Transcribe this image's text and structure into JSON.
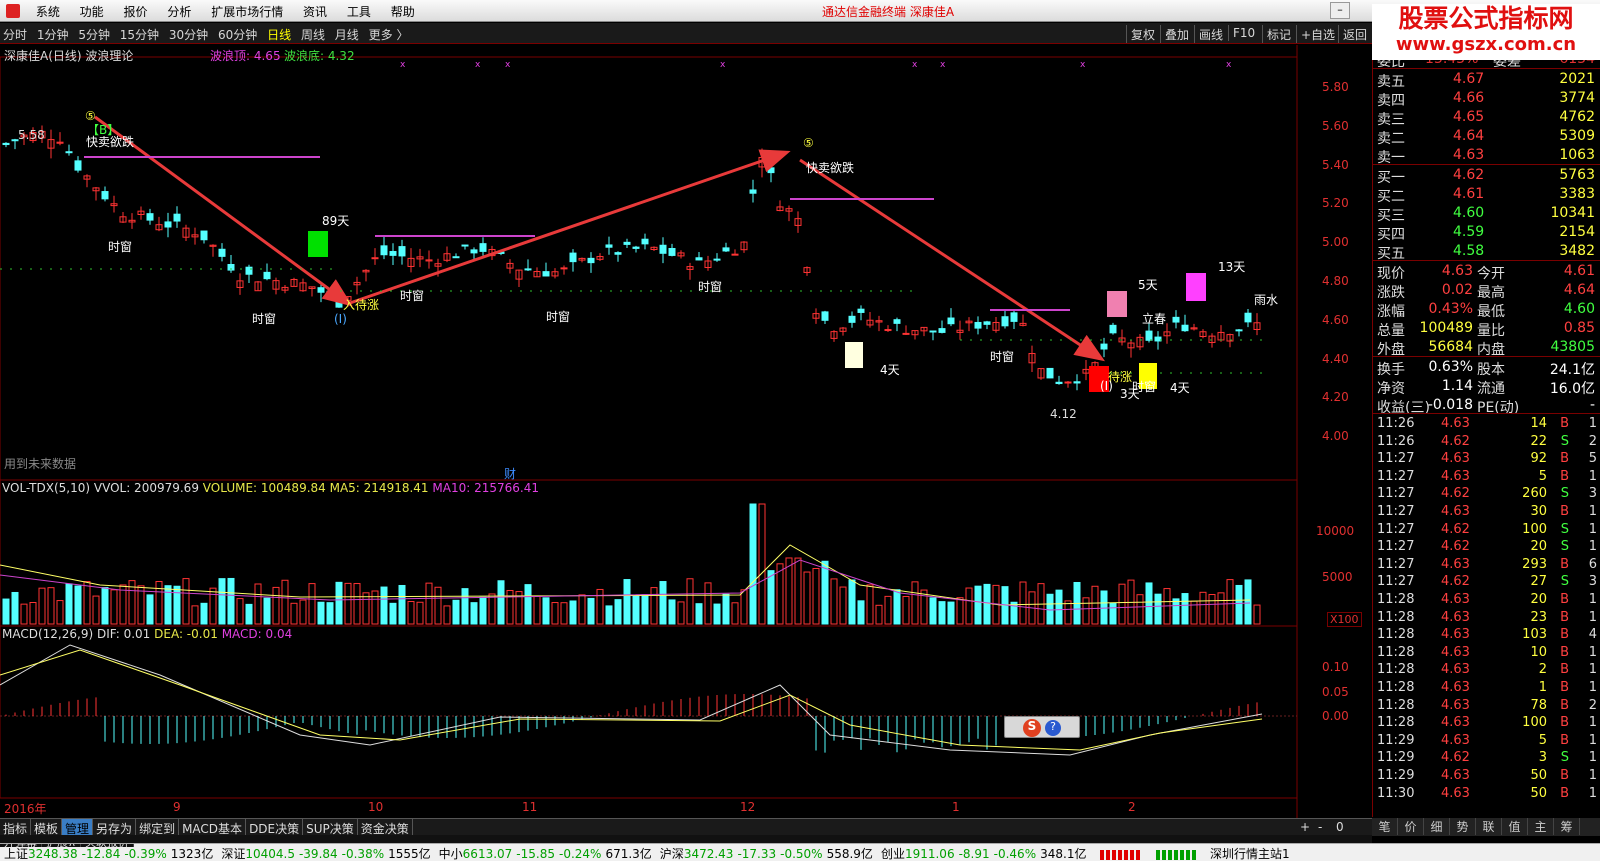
{
  "menu": {
    "items": [
      "系统",
      "功能",
      "报价",
      "分析",
      "扩展市场行情",
      "资讯",
      "工具",
      "帮助"
    ],
    "title": "通达信金融终端  深康佳A"
  },
  "toolbar": {
    "periods": [
      "分时",
      "1分钟",
      "5分钟",
      "15分钟",
      "30分钟",
      "60分钟",
      "日线",
      "周线",
      "月线",
      "更多 〉"
    ],
    "active": "日线",
    "right": [
      "复权",
      "叠加",
      "画线",
      "F10",
      "标记",
      "+自选",
      "返回"
    ]
  },
  "logo": {
    "line1": "股票公式指标网",
    "line2": "www.gszx.com.cn"
  },
  "main_chart": {
    "title": "深康佳A(日线) 波浪理论",
    "wave_top_label": "波浪顶: 4.65",
    "wave_bottom_label": "波浪底: 4.32",
    "price_axis": [
      "5.80",
      "5.60",
      "5.40",
      "5.20",
      "5.00",
      "4.80",
      "4.60",
      "4.40",
      "4.20",
      "4.00"
    ],
    "high_label": "5.58",
    "low_label": "4.12",
    "future_data_note": "用到未来数据",
    "cai_marker": "财",
    "annotations": [
      "时窗",
      "时窗",
      "时窗",
      "时窗",
      "时窗",
      "时窗",
      "时窗",
      "快卖欲跌",
      "快卖欲跌",
      "入待涨",
      "待涨",
      "立春",
      "雨水",
      "89天",
      "5天",
      "13天",
      "4天",
      "3天",
      "4天",
      "(I)",
      "(I)",
      "⑤",
      "⑤",
      "【B】"
    ]
  },
  "volume_panel": {
    "title": "VOL-TDX(5,10)",
    "vvol": "VVOL: 200979.69",
    "volume": "VOLUME: 100489.84",
    "ma5": "MA5: 214918.41",
    "ma10": "MA10: 215766.41",
    "axis": [
      "10000",
      "5000"
    ],
    "unit": "X100"
  },
  "macd_panel": {
    "title": "MACD(12,26,9)",
    "dif": "DIF: 0.01",
    "dea": "DEA: -0.01",
    "macd": "MACD: 0.04",
    "axis": [
      "0.10",
      "0.05",
      "0.00"
    ]
  },
  "date_axis": [
    "2016年",
    "9",
    "10",
    "11",
    "12",
    "1",
    "2"
  ],
  "quote": {
    "header": {
      "label": "委比",
      "value": "13.43%",
      "label2": "委差",
      "value2": "6134"
    },
    "asks": [
      {
        "label": "卖五",
        "price": "4.67",
        "vol": "2021"
      },
      {
        "label": "卖四",
        "price": "4.66",
        "vol": "3774"
      },
      {
        "label": "卖三",
        "price": "4.65",
        "vol": "4762"
      },
      {
        "label": "卖二",
        "price": "4.64",
        "vol": "5309"
      },
      {
        "label": "卖一",
        "price": "4.63",
        "vol": "1063"
      }
    ],
    "bids": [
      {
        "label": "买一",
        "price": "4.62",
        "vol": "5763"
      },
      {
        "label": "买二",
        "price": "4.61",
        "vol": "3383"
      },
      {
        "label": "买三",
        "price": "4.60",
        "vol": "10341"
      },
      {
        "label": "买四",
        "price": "4.59",
        "vol": "2154"
      },
      {
        "label": "买五",
        "price": "4.58",
        "vol": "3482"
      }
    ],
    "stats": [
      {
        "l1": "现价",
        "v1": "4.63",
        "l2": "今开",
        "v2": "4.61"
      },
      {
        "l1": "涨跌",
        "v1": "0.02",
        "l2": "最高",
        "v2": "4.64"
      },
      {
        "l1": "涨幅",
        "v1": "0.43%",
        "l2": "最低",
        "v2": "4.60"
      },
      {
        "l1": "总量",
        "v1": "100489",
        "l2": "量比",
        "v2": "0.85"
      },
      {
        "l1": "外盘",
        "v1": "56684",
        "l2": "内盘",
        "v2": "43805"
      }
    ],
    "stats2": [
      {
        "l1": "换手",
        "v1": "0.63%",
        "l2": "股本",
        "v2": "24.1亿"
      },
      {
        "l1": "净资",
        "v1": "1.14",
        "l2": "流通",
        "v2": "16.0亿"
      },
      {
        "l1": "收益(三)",
        "v1": "-0.018",
        "l2": "PE(动)",
        "v2": "-"
      }
    ]
  },
  "ticks": [
    {
      "t": "11:26",
      "p": "4.63",
      "v": "14",
      "bs": "B",
      "n": "1"
    },
    {
      "t": "11:26",
      "p": "4.62",
      "v": "22",
      "bs": "S",
      "n": "2"
    },
    {
      "t": "11:27",
      "p": "4.63",
      "v": "92",
      "bs": "B",
      "n": "5"
    },
    {
      "t": "11:27",
      "p": "4.63",
      "v": "5",
      "bs": "B",
      "n": "1"
    },
    {
      "t": "11:27",
      "p": "4.62",
      "v": "260",
      "bs": "S",
      "n": "3"
    },
    {
      "t": "11:27",
      "p": "4.63",
      "v": "30",
      "bs": "B",
      "n": "1"
    },
    {
      "t": "11:27",
      "p": "4.62",
      "v": "100",
      "bs": "S",
      "n": "1"
    },
    {
      "t": "11:27",
      "p": "4.62",
      "v": "20",
      "bs": "S",
      "n": "1"
    },
    {
      "t": "11:27",
      "p": "4.63",
      "v": "293",
      "bs": "B",
      "n": "6"
    },
    {
      "t": "11:27",
      "p": "4.62",
      "v": "27",
      "bs": "S",
      "n": "3"
    },
    {
      "t": "11:28",
      "p": "4.63",
      "v": "20",
      "bs": "B",
      "n": "1"
    },
    {
      "t": "11:28",
      "p": "4.63",
      "v": "23",
      "bs": "B",
      "n": "1"
    },
    {
      "t": "11:28",
      "p": "4.63",
      "v": "103",
      "bs": "B",
      "n": "4"
    },
    {
      "t": "11:28",
      "p": "4.63",
      "v": "10",
      "bs": "B",
      "n": "1"
    },
    {
      "t": "11:28",
      "p": "4.63",
      "v": "2",
      "bs": "B",
      "n": "1"
    },
    {
      "t": "11:28",
      "p": "4.63",
      "v": "1",
      "bs": "B",
      "n": "1"
    },
    {
      "t": "11:28",
      "p": "4.63",
      "v": "78",
      "bs": "B",
      "n": "2"
    },
    {
      "t": "11:28",
      "p": "4.63",
      "v": "100",
      "bs": "B",
      "n": "1"
    },
    {
      "t": "11:29",
      "p": "4.63",
      "v": "5",
      "bs": "B",
      "n": "1"
    },
    {
      "t": "11:29",
      "p": "4.62",
      "v": "3",
      "bs": "S",
      "n": "1"
    },
    {
      "t": "11:29",
      "p": "4.63",
      "v": "50",
      "bs": "B",
      "n": "1"
    },
    {
      "t": "11:30",
      "p": "4.63",
      "v": "50",
      "bs": "B",
      "n": "1"
    }
  ],
  "bottom_tabs": [
    "指标",
    "模板",
    "管理",
    "另存为",
    "绑定到",
    "MACD基本",
    "DDE决策",
    "SUP决策",
    "资金决策"
  ],
  "active_bottom_tab": "管理",
  "sub_tabs": [
    "开弹幕",
    "扩展∧",
    "关联报价"
  ],
  "side_tabs": [
    "笔",
    "价",
    "细",
    "势",
    "联",
    "值",
    "主",
    "筹"
  ],
  "indices": [
    {
      "name": "上证",
      "val": "3248.38",
      "chg": "-12.84",
      "pct": "-0.39%",
      "amt": "1323亿"
    },
    {
      "name": "深证",
      "val": "10404.5",
      "chg": "-39.84",
      "pct": "-0.38%",
      "amt": "1555亿"
    },
    {
      "name": "中小",
      "val": "6613.07",
      "chg": "-15.85",
      "pct": "-0.24%",
      "amt": "671.3亿"
    },
    {
      "name": "沪深",
      "val": "3472.43",
      "chg": "-17.33",
      "pct": "-0.50%",
      "amt": "558.9亿"
    },
    {
      "name": "创业",
      "val": "1911.06",
      "chg": "-8.91",
      "pct": "-0.46%",
      "amt": "348.1亿"
    }
  ],
  "status_right": "深圳行情主站1",
  "colors": {
    "up": "#ff3333",
    "down": "#54ffff",
    "axis": "#7a0000",
    "ma": "#ffff66",
    "ma2": "#cc44cc",
    "arrow": "#e83a3a"
  }
}
